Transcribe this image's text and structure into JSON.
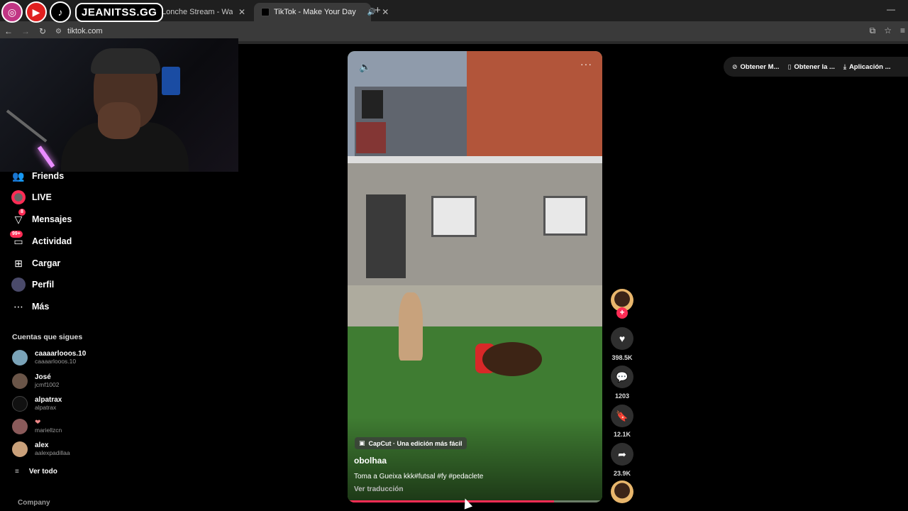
{
  "overlay": {
    "brand": "JEANITSS.GG",
    "social_icons": [
      "instagram-icon",
      "youtube-icon",
      "tiktok-icon"
    ]
  },
  "browser": {
    "tabs": [
      {
        "title": "Lonche Stream - Watch Live or",
        "active": false
      },
      {
        "title": "TikTok - Make Your Day",
        "active": true
      }
    ],
    "url": "tiktok.com"
  },
  "sidebar": {
    "items": [
      {
        "label": "Friends",
        "icon": "friends-icon"
      },
      {
        "label": "LIVE",
        "icon": "live-icon"
      },
      {
        "label": "Mensajes",
        "icon": "messages-icon",
        "badge": "8"
      },
      {
        "label": "Actividad",
        "icon": "activity-icon",
        "badge": "99+"
      },
      {
        "label": "Cargar",
        "icon": "upload-icon"
      },
      {
        "label": "Perfil",
        "icon": "profile-icon"
      },
      {
        "label": "Más",
        "icon": "more-icon"
      }
    ],
    "following_title": "Cuentas que sigues",
    "accounts": [
      {
        "name": "caaaarlooos.10",
        "username": "caaaarlooos.10"
      },
      {
        "name": "José",
        "username": "jcmf1002"
      },
      {
        "name": "alpatrax",
        "username": "alpatrax"
      },
      {
        "name": "❤",
        "username": "mariellzcn"
      },
      {
        "name": "alex",
        "username": "aalexpadillaa"
      }
    ],
    "see_all": "Ver todo",
    "company": "Company"
  },
  "video": {
    "capcut_label": "CapCut · Una edición más fácil",
    "author": "obolhaa",
    "caption": "Toma a Gueixa kkk#futsal #fy #pedaclete",
    "translate": "Ver traducción",
    "progress": 0.81
  },
  "actions": {
    "likes": "398.5K",
    "comments": "1203",
    "saves": "12.1K",
    "shares": "23.9K"
  },
  "top_pills": [
    {
      "label": "Obtener M...",
      "icon": "coin-icon"
    },
    {
      "label": "Obtener la ...",
      "icon": "phone-icon"
    },
    {
      "label": "Aplicación ...",
      "icon": "download-icon"
    }
  ]
}
